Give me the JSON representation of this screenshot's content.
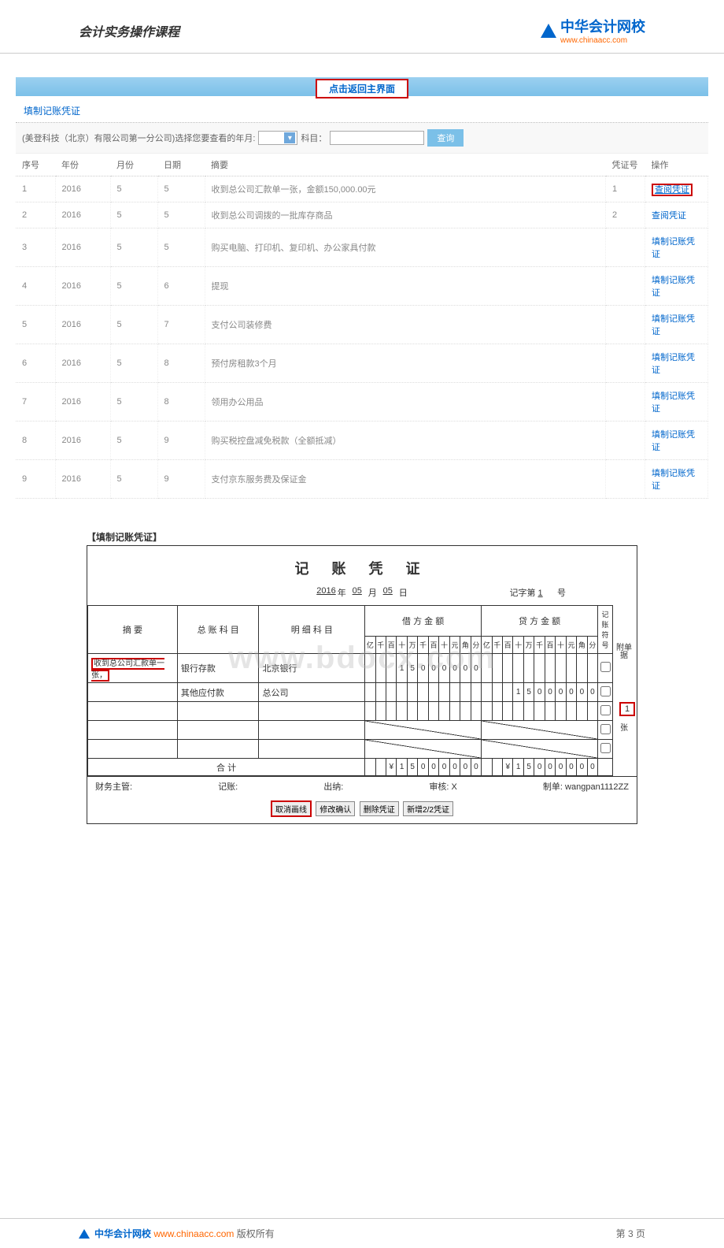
{
  "header": {
    "course_title": "会计实务操作课程",
    "logo_cn": "中华会计网校",
    "logo_url": "www.chinaacc.com"
  },
  "topbar": {
    "return_label": "点击返回主界面"
  },
  "listSection": {
    "title": "填制记账凭证",
    "filter_prefix": "(美登科技（北京）有限公司第一分公司)选择您要查看的年月:",
    "subject_label": "科目：",
    "search_label": "查询",
    "columns": {
      "seq": "序号",
      "year": "年份",
      "month": "月份",
      "day": "日期",
      "summary": "摘要",
      "vno": "凭证号",
      "op": "操作"
    },
    "rows": [
      {
        "seq": "1",
        "year": "2016",
        "month": "5",
        "day": "5",
        "summary": "收到总公司汇款单一张，金额150,000.00元",
        "vno": "1",
        "op": "查阅凭证",
        "highlight": true
      },
      {
        "seq": "2",
        "year": "2016",
        "month": "5",
        "day": "5",
        "summary": "收到总公司调拨的一批库存商品",
        "vno": "2",
        "op": "查阅凭证"
      },
      {
        "seq": "3",
        "year": "2016",
        "month": "5",
        "day": "5",
        "summary": "购买电脑、打印机、复印机、办公家具付款",
        "vno": "",
        "op": "填制记账凭证"
      },
      {
        "seq": "4",
        "year": "2016",
        "month": "5",
        "day": "6",
        "summary": "提现",
        "vno": "",
        "op": "填制记账凭证"
      },
      {
        "seq": "5",
        "year": "2016",
        "month": "5",
        "day": "7",
        "summary": "支付公司装修费",
        "vno": "",
        "op": "填制记账凭证"
      },
      {
        "seq": "6",
        "year": "2016",
        "month": "5",
        "day": "8",
        "summary": "预付房租款3个月",
        "vno": "",
        "op": "填制记账凭证"
      },
      {
        "seq": "7",
        "year": "2016",
        "month": "5",
        "day": "8",
        "summary": "领用办公用品",
        "vno": "",
        "op": "填制记账凭证"
      },
      {
        "seq": "8",
        "year": "2016",
        "month": "5",
        "day": "9",
        "summary": "购买税控盘减免税款（全额抵减）",
        "vno": "",
        "op": "填制记账凭证"
      },
      {
        "seq": "9",
        "year": "2016",
        "month": "5",
        "day": "9",
        "summary": "支付京东服务费及保证金",
        "vno": "",
        "op": "填制记账凭证"
      }
    ]
  },
  "voucherForm": {
    "section_title": "【填制记账凭证】",
    "title": "记 账 凭 证",
    "date": {
      "year": "2016",
      "month": "05",
      "day": "05",
      "year_lbl": "年",
      "month_lbl": "月",
      "day_lbl": "日"
    },
    "record_no_prefix": "记字第",
    "record_no": "1",
    "record_no_suffix": "号",
    "headers": {
      "summary": "摘 要",
      "general": "总 账 科 目",
      "detail": "明 细 科 目",
      "debit": "借 方 金 额",
      "credit": "贷 方 金 额",
      "mark": "记账符号"
    },
    "digit_headers": [
      "亿",
      "千",
      "百",
      "十",
      "万",
      "千",
      "百",
      "十",
      "元",
      "角",
      "分"
    ],
    "side_attach": "附单据",
    "side_count": "1",
    "side_zhang": "张",
    "lines": [
      {
        "summary_text": "收到总公司汇款单一张，",
        "summary_highlight": true,
        "general": "银行存款",
        "detail": "北京银行",
        "debit": [
          "",
          "",
          "",
          "1",
          "5",
          "0",
          "0",
          "0",
          "0",
          "0",
          "0"
        ],
        "credit": [
          "",
          "",
          "",
          "",
          "",
          "",
          "",
          "",
          "",
          "",
          ""
        ]
      },
      {
        "summary_text": "",
        "general": "其他应付款",
        "detail": "总公司",
        "debit": [
          "",
          "",
          "",
          "",
          "",
          "",
          "",
          "",
          "",
          "",
          ""
        ],
        "credit": [
          "",
          "",
          "",
          "1",
          "5",
          "0",
          "0",
          "0",
          "0",
          "0",
          "0"
        ]
      }
    ],
    "total_label": "合 计",
    "total_debit": [
      "",
      "",
      "¥",
      "1",
      "5",
      "0",
      "0",
      "0",
      "0",
      "0",
      "0"
    ],
    "total_credit": [
      "",
      "",
      "¥",
      "1",
      "5",
      "0",
      "0",
      "0",
      "0",
      "0",
      "0"
    ],
    "signatures": {
      "supervisor_lbl": "财务主管:",
      "bookkeeper_lbl": "记账:",
      "cashier_lbl": "出纳:",
      "auditor_lbl": "审核:",
      "auditor_val": "X",
      "preparer_lbl": "制单:",
      "preparer_val": "wangpan1112ZZ"
    },
    "buttons": {
      "cancel": "取消画线",
      "confirm": "修改确认",
      "delete": "删除凭证",
      "add": "新增2/2凭证"
    }
  },
  "watermark": "www.bdocx.com",
  "footer": {
    "logo_cn": "中华会计网校",
    "url": "www.chinaacc.com",
    "copyright": "版权所有",
    "page": "第 3 页"
  }
}
